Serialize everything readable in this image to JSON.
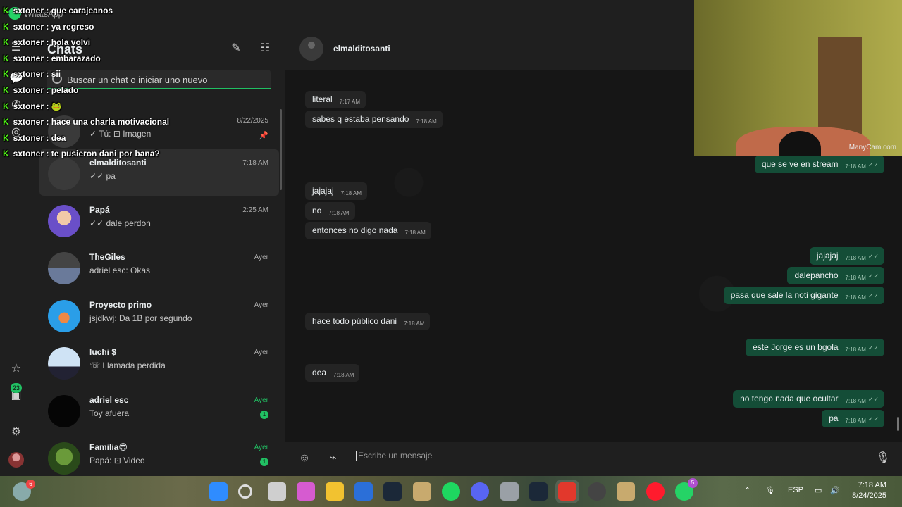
{
  "window": {
    "app_title": "WhatsApp"
  },
  "rail": {
    "updates_badge": "23"
  },
  "chatlist": {
    "heading": "Chats",
    "search_placeholder": "Buscar un chat o iniciar uno nuevo",
    "items": [
      {
        "name": "",
        "time": "8/22/2025",
        "preview": "✓ Tú: ⊡ Imagen",
        "pinned": true
      },
      {
        "name": "elmalditosanti",
        "time": "7:18 AM",
        "preview": "✓✓ pa",
        "active": true
      },
      {
        "name": "Papá",
        "time": "2:25 AM",
        "preview": "✓✓ dale perdon"
      },
      {
        "name": "TheGiles",
        "time": "Ayer",
        "preview": "adriel esc: Okas"
      },
      {
        "name": "Proyecto primo",
        "time": "Ayer",
        "preview": "jsjdkwj: Da 1B por segundo"
      },
      {
        "name": "luchi $",
        "time": "Ayer",
        "preview": "☏ Llamada perdida"
      },
      {
        "name": "adriel esc",
        "time": "Ayer",
        "preview": "Toy afuera",
        "unread": "1"
      },
      {
        "name": "Familia😎",
        "time": "Ayer",
        "preview": "Papá: ⊡ Video",
        "unread": "1"
      }
    ]
  },
  "conversation": {
    "contact": "elmalditosanti",
    "messages": [
      {
        "dir": "in",
        "text": "literal",
        "time": "7:17 AM"
      },
      {
        "dir": "in",
        "text": "sabes q estaba pensando",
        "time": "7:18 AM"
      },
      {
        "dir": "out",
        "text": "que se ve en stream",
        "time": "7:18 AM"
      },
      {
        "dir": "in",
        "text": "jajajaj",
        "time": "7:18 AM"
      },
      {
        "dir": "in",
        "text": "no",
        "time": "7:18 AM"
      },
      {
        "dir": "in",
        "text": "entonces no digo nada",
        "time": "7:18 AM"
      },
      {
        "dir": "out",
        "text": "jajajaj",
        "time": "7:18 AM"
      },
      {
        "dir": "out",
        "text": "dalepancho",
        "time": "7:18 AM"
      },
      {
        "dir": "out",
        "text": "pasa que sale la noti gigante",
        "time": "7:18 AM"
      },
      {
        "dir": "in",
        "text": "hace todo público dani",
        "time": "7:18 AM"
      },
      {
        "dir": "out",
        "text": "este Jorge es un bgola",
        "time": "7:18 AM"
      },
      {
        "dir": "in",
        "text": "dea",
        "time": "7:18 AM"
      },
      {
        "dir": "out",
        "text": "no tengo nada que ocultar",
        "time": "7:18 AM"
      },
      {
        "dir": "out",
        "text": "pa",
        "time": "7:18 AM"
      }
    ],
    "composer_placeholder": "Escribe un mensaje"
  },
  "webcam": {
    "brand": "ManyCam.com"
  },
  "stream_chat": [
    {
      "user": "sxtoner",
      "text": "que carajeanos"
    },
    {
      "user": "sxtoner",
      "text": "ya regreso"
    },
    {
      "user": "sxtoner",
      "text": "hola volvi"
    },
    {
      "user": "sxtoner",
      "text": "embarazado"
    },
    {
      "user": "sxtoner",
      "text": "sii"
    },
    {
      "user": "sxtoner",
      "text": "pelado"
    },
    {
      "user": "sxtoner",
      "text": "🐸"
    },
    {
      "user": "sxtoner",
      "text": "hace una charla motivacional"
    },
    {
      "user": "sxtoner",
      "text": "dea"
    },
    {
      "user": "sxtoner",
      "text": "te pusieron dani por bana?"
    }
  ],
  "taskbar": {
    "weather_badge": "6",
    "discord_badge": "",
    "whatsapp_badge": "5",
    "language": "ESP",
    "time": "7:18 AM",
    "date": "8/24/2025",
    "icons": [
      "start-icon",
      "search-icon",
      "task-view-icon",
      "copilot-icon",
      "file-explorer-icon",
      "store-icon",
      "steam-icon",
      "lol-launcher-icon",
      "spotify-icon",
      "discord-icon",
      "settings-icon",
      "steam-alt-icon",
      "ea-icon",
      "obs-icon",
      "league-icon",
      "opera-icon",
      "whatsapp-icon"
    ]
  }
}
